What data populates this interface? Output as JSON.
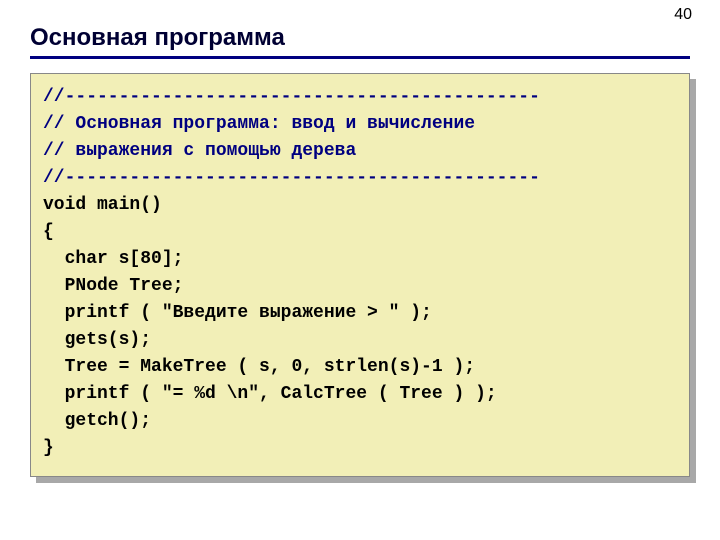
{
  "page_number": "40",
  "title": "Основная программа",
  "code": {
    "c1": "//--------------------------------------------",
    "c2": "// Основная программа: ввод и вычисление",
    "c3": "// выражения с помощью дерева",
    "c4": "//--------------------------------------------",
    "l1": "void main()",
    "l2": "{",
    "l3": "  char s[80];",
    "l4": "  PNode Tree;",
    "l5": "  printf ( \"Введите выражение > \" );",
    "l6": "  gets(s);",
    "l7": "  Tree = MakeTree ( s, 0, strlen(s)-1 );",
    "l8": "  printf ( \"= %d \\n\", CalcTree ( Tree ) );",
    "l9": "  getch();",
    "l10": "}"
  }
}
